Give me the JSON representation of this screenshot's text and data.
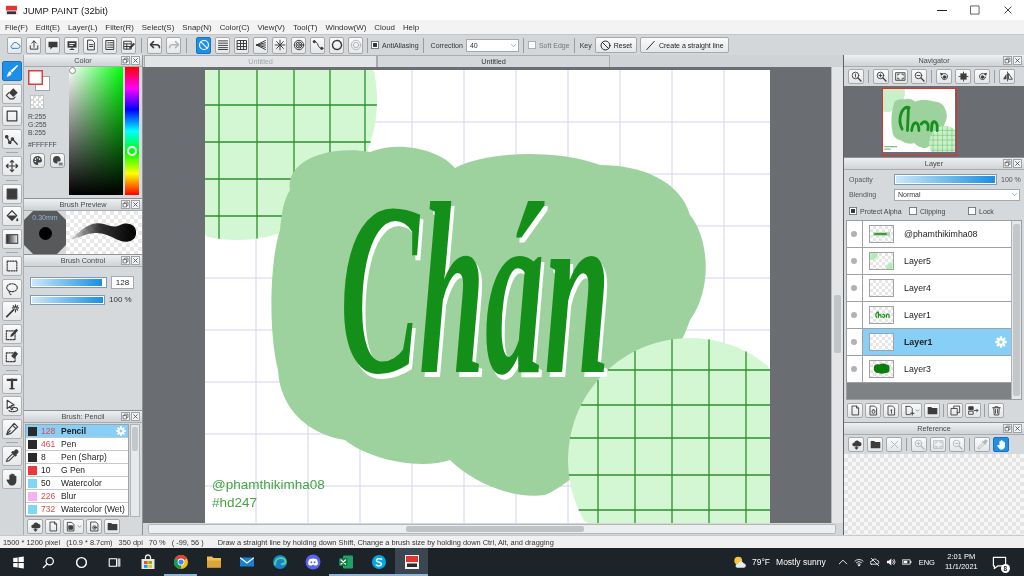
{
  "window": {
    "title": "JUMP PAINT (32bit)"
  },
  "menu": [
    "File(F)",
    "Edit(E)",
    "Layer(L)",
    "Filter(R)",
    "Select(S)",
    "Snap(N)",
    "Color(C)",
    "View(V)",
    "Tool(T)",
    "Window(W)",
    "Cloud",
    "Help"
  ],
  "toolbar": {
    "history": [
      {
        "disabled": false
      },
      {
        "disabled": true
      }
    ],
    "snap_modes": [
      {
        "selected": true,
        "disabled": false
      },
      {
        "selected": false,
        "disabled": false
      },
      {
        "selected": false,
        "disabled": false
      },
      {
        "selected": false,
        "disabled": false
      },
      {
        "selected": false,
        "disabled": false
      },
      {
        "selected": false,
        "disabled": false
      },
      {
        "selected": false,
        "disabled": false
      },
      {
        "selected": false,
        "disabled": false
      },
      {
        "selected": false,
        "disabled": true
      }
    ],
    "antialiasing": {
      "label": "AntiAliasing",
      "checked": true
    },
    "correction": {
      "label": "Correction",
      "value": "40"
    },
    "soft_edge": {
      "label": "Soft Edge",
      "checked": false,
      "disabled": true
    },
    "key_label": "Key",
    "buttons": [
      "Reset",
      "Create a straight line"
    ]
  },
  "tools": [
    {
      "selected": true
    },
    {
      "selected": false
    },
    {
      "selected": false
    },
    {
      "selected": false
    },
    {
      "selected": false
    },
    {
      "selected": false
    },
    {
      "selected": false
    },
    {
      "selected": false
    },
    {
      "selected": false
    },
    {
      "selected": false
    },
    {
      "selected": false
    },
    {
      "selected": false
    },
    {
      "selected": false
    },
    {
      "selected": false
    },
    {
      "selected": false
    },
    {
      "selected": false
    },
    {
      "selected": false
    },
    {
      "selected": false
    }
  ],
  "color_panel": {
    "title": "Color",
    "rgb": [
      "R:255",
      "G:255",
      "B:255"
    ],
    "hex": "#FFFFFF",
    "hue": {
      "level": 0.34
    }
  },
  "brush_preview": {
    "title": "Brush Preview",
    "size": "0.30mm"
  },
  "brush_control": {
    "title": "Brush Control",
    "sliders": [
      {
        "kind": "input",
        "level": 0.96,
        "value": "128"
      },
      {
        "kind": "text",
        "level": 1,
        "value": "100 %"
      }
    ]
  },
  "brush_list": {
    "title": "Brush: Pencil",
    "items": [
      {
        "color": "#2b2b2b",
        "size": {
          "label": "128",
          "highlighted": true
        },
        "name": "Pencil",
        "selected": true
      },
      {
        "color": "#2b2b2b",
        "size": {
          "label": "461",
          "highlighted": true
        },
        "name": "Pen",
        "selected": false
      },
      {
        "color": "#2b2b2b",
        "size": {
          "label": "8",
          "highlighted": false
        },
        "name": "Pen (Sharp)",
        "selected": false
      },
      {
        "color": "#e83a3a",
        "size": {
          "label": "10",
          "highlighted": false
        },
        "name": "G Pen",
        "selected": false
      },
      {
        "color": "#7fd6f7",
        "size": {
          "label": "50",
          "highlighted": false
        },
        "name": "Watercolor",
        "selected": false
      },
      {
        "color": "#f5b1f2",
        "size": {
          "label": "226",
          "highlighted": true
        },
        "name": "Blur",
        "selected": false
      },
      {
        "color": "#7fd6f7",
        "size": {
          "label": "732",
          "highlighted": true
        },
        "name": "Watercolor (Wet)",
        "selected": false
      }
    ]
  },
  "document_tabs": [
    {
      "label": "Untitled",
      "selected": false
    },
    {
      "label": "Untitled",
      "selected": true
    }
  ],
  "canvas": {
    "lettering": "Chán",
    "credits": [
      "@phamthikimha08",
      "#hd247"
    ]
  },
  "navigator": {
    "title": "Navigator"
  },
  "layer_panel": {
    "title": "Layer",
    "opacity": {
      "label": "Opacity",
      "level": 1,
      "value": "100 %"
    },
    "blending": {
      "label": "Blending",
      "value": "Normal"
    },
    "options": [
      {
        "label": "Protect Alpha",
        "checked": true
      },
      {
        "label": "Clipping",
        "checked": false
      },
      {
        "label": "Lock",
        "checked": false
      }
    ],
    "layers": [
      {
        "name": "@phamthikimha08",
        "kind": "text",
        "selected": false
      },
      {
        "name": "Layer5",
        "kind": "corners",
        "selected": false
      },
      {
        "name": "Layer4",
        "kind": "empty",
        "selected": false
      },
      {
        "name": "Layer1",
        "kind": "lettering",
        "selected": false
      },
      {
        "name": "Layer1",
        "kind": "empty",
        "selected": true
      },
      {
        "name": "Layer3",
        "kind": "blob",
        "selected": false
      }
    ]
  },
  "reference": {
    "title": "Reference",
    "tools": [
      {
        "selected": false,
        "disabled": false
      },
      {
        "selected": false,
        "disabled": false
      },
      {
        "selected": false,
        "disabled": true
      },
      {
        "selected": false,
        "disabled": true
      },
      {
        "selected": false,
        "disabled": true
      },
      {
        "selected": false,
        "disabled": true
      },
      {
        "selected": false,
        "disabled": true
      },
      {
        "selected": true,
        "disabled": false
      }
    ]
  },
  "status_bar": [
    "1500 * 1200 pixel",
    "(10.9 * 8.7cm)",
    "350 dpi",
    "70 %",
    "( -99, 56 )",
    "Draw a straight line by holding down Shift, Change a brush size by holding down Ctrl, Alt, and dragging"
  ],
  "taskbar": {
    "apps": [
      {
        "running": false,
        "selected": false
      },
      {
        "running": true,
        "selected": false
      },
      {
        "running": false,
        "selected": false
      },
      {
        "running": false,
        "selected": false
      },
      {
        "running": false,
        "selected": false
      },
      {
        "running": false,
        "selected": false
      },
      {
        "running": true,
        "selected": false
      },
      {
        "running": true,
        "selected": false
      },
      {
        "running": true,
        "selected": true
      }
    ],
    "weather": {
      "temperature": "79°F",
      "condition": "Mostly sunny"
    },
    "language": "ENG",
    "time": "2:01 PM",
    "date": "11/1/2021",
    "notifications": "8"
  }
}
